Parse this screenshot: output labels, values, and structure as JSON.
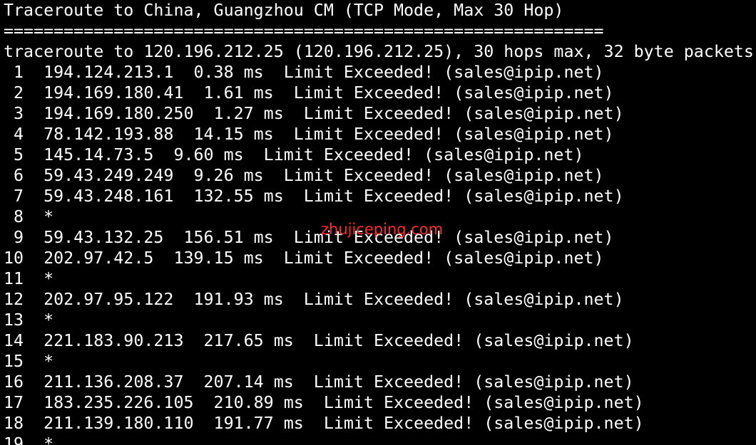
{
  "terminal": {
    "lines": [
      "Traceroute to China, Guangzhou CM (TCP Mode, Max 30 Hop)",
      "============================================================",
      "traceroute to 120.196.212.25 (120.196.212.25), 30 hops max, 32 byte packets",
      " 1  194.124.213.1  0.38 ms  Limit Exceeded! (sales@ipip.net)",
      " 2  194.169.180.41  1.61 ms  Limit Exceeded! (sales@ipip.net)",
      " 3  194.169.180.250  1.27 ms  Limit Exceeded! (sales@ipip.net)",
      " 4  78.142.193.88  14.15 ms  Limit Exceeded! (sales@ipip.net)",
      " 5  145.14.73.5  9.60 ms  Limit Exceeded! (sales@ipip.net)",
      " 6  59.43.249.249  9.26 ms  Limit Exceeded! (sales@ipip.net)",
      " 7  59.43.248.161  132.55 ms  Limit Exceeded! (sales@ipip.net)",
      " 8  *",
      " 9  59.43.132.25  156.51 ms  Limit Exceeded! (sales@ipip.net)",
      "10  202.97.42.5  139.15 ms  Limit Exceeded! (sales@ipip.net)",
      "11  *",
      "12  202.97.95.122  191.93 ms  Limit Exceeded! (sales@ipip.net)",
      "13  *",
      "14  221.183.90.213  217.65 ms  Limit Exceeded! (sales@ipip.net)",
      "15  *",
      "16  211.136.208.37  207.14 ms  Limit Exceeded! (sales@ipip.net)",
      "17  183.235.226.105  210.89 ms  Limit Exceeded! (sales@ipip.net)",
      "18  211.139.180.110  191.77 ms  Limit Exceeded! (sales@ipip.net)",
      "19  *"
    ],
    "watermark": "zhujiceping.com",
    "colors": {
      "background": "#000000",
      "text": "#ffffff",
      "watermark": "#ff2b2b"
    }
  }
}
